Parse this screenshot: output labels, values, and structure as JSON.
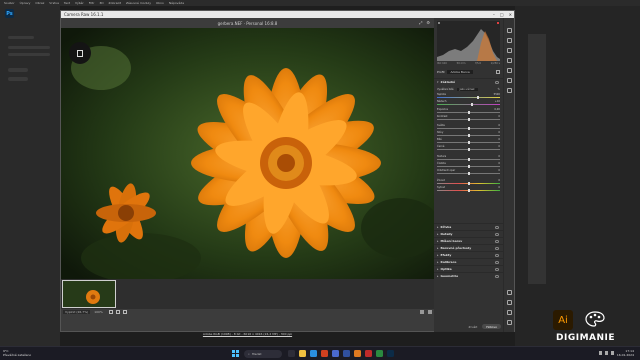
{
  "ps": {
    "logo": "Ps",
    "menu": [
      "Soubor",
      "Úpravy",
      "Obraz",
      "Vrstva",
      "Text",
      "Výběr",
      "Filtr",
      "3D",
      "Zobrazit",
      "Zásuvné moduly",
      "Okno",
      "Nápověda"
    ]
  },
  "camera_raw": {
    "title": "Camera Raw 16.1.1",
    "filename": "gerbera.NEF  ·  Personal  16:8.8",
    "zoom": "Vyplnit (26,7%)",
    "zoom_100": "100%",
    "info_line": "Adobe RGB (1998) - 8 bit - 6016 x 4016 (24,2 MP) - 300 ppi",
    "histogram_readout": [
      "ISO 100",
      "50 mm",
      "f/5.6",
      "1/250 s"
    ],
    "profile_label": "Profil",
    "profile_value": "Adobe Barva",
    "wb_label": "Vyvážení bílé",
    "wb_value": "Jako snímek",
    "panels": {
      "zakladni": "Základní",
      "krivka": "Křivka",
      "detaily": "Detaily",
      "miseni_barev": "Míšení barev",
      "barevna_prechod": "Barevné přechody",
      "efekty": "Efekty",
      "kalibrace": "Kalibrace",
      "optika": "Optika",
      "geometrie": "Geometrie"
    },
    "sliders": [
      {
        "label": "Teplota",
        "value": "5500"
      },
      {
        "label": "Nádech",
        "value": "+10"
      },
      {
        "label": "Expozice",
        "value": "0,00"
      },
      {
        "label": "Kontrast",
        "value": "0"
      },
      {
        "label": "Světla",
        "value": "0"
      },
      {
        "label": "Stíny",
        "value": "0"
      },
      {
        "label": "Bílé",
        "value": "0"
      },
      {
        "label": "Černé",
        "value": "0"
      },
      {
        "label": "Textura",
        "value": "0"
      },
      {
        "label": "Čistota",
        "value": "0"
      },
      {
        "label": "Odstranit opar",
        "value": "0"
      },
      {
        "label": "Živost",
        "value": "0"
      },
      {
        "label": "Sytost",
        "value": "0"
      }
    ],
    "cancel_label": "Zrušit",
    "ok_label": "Hotovo"
  },
  "overlay": {
    "ai_logo": "Ai",
    "brand_dig": "DIGI",
    "brand_manie": "MANIE"
  },
  "taskbar": {
    "temp": "9°C",
    "weather": "Převážně zataženo",
    "search": "Hledat",
    "time": "17:14",
    "date": "16.01.2024"
  },
  "colors": {
    "accent_orange": "#ff9a00",
    "ps_blue": "#31a8ff",
    "windows_blue": "#4cc2ff"
  }
}
